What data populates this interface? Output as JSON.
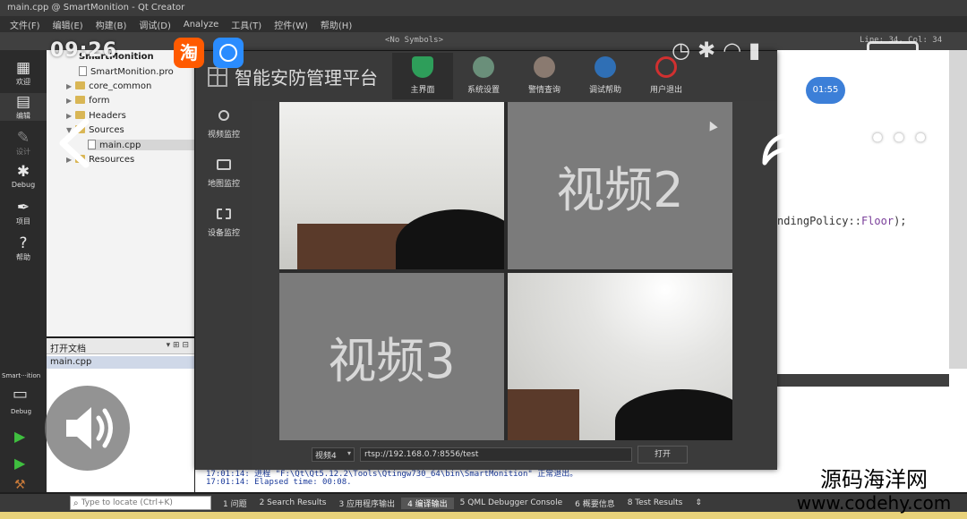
{
  "ide": {
    "window_title": "main.cpp @ SmartMonition - Qt Creator",
    "menu": [
      "文件(F)",
      "编辑(E)",
      "构建(B)",
      "调试(D)",
      "Analyze",
      "工具(T)",
      "控件(W)",
      "帮助(H)"
    ],
    "top_strip": {
      "symbols": "<No Symbols>",
      "line_col": "Line: 34, Col: 34"
    },
    "modes": [
      "欢迎",
      "编辑",
      "设计",
      "Debug",
      "项目",
      "帮助"
    ],
    "project_tree": [
      {
        "label": "SmartMonition",
        "kind": "root"
      },
      {
        "label": "SmartMonition.pro",
        "kind": "file"
      },
      {
        "label": "core_common",
        "kind": "folder"
      },
      {
        "label": "form",
        "kind": "folder"
      },
      {
        "label": "Headers",
        "kind": "folder"
      },
      {
        "label": "Sources",
        "kind": "folder"
      },
      {
        "label": "main.cpp",
        "kind": "file"
      },
      {
        "label": "Resources",
        "kind": "folder"
      }
    ],
    "open_docs": {
      "title": "打开文档",
      "items": [
        "main.cpp"
      ]
    },
    "run_selector": {
      "project": "Smart···ition",
      "config": "Debug"
    },
    "editor_visible_code": {
      "prefix": "ndingPolicy",
      "separator": "::",
      "keyword": "Floor",
      "suffix": ");"
    },
    "output_lines": [
      "17:01:14: 进程 \"F:\\Qt\\Qt5.12.2\\Tools\\Qtingw730_64\\bin\\SmartMonition\" 正常退出。",
      "17:01:14: Elapsed time: 00:08."
    ],
    "locator_placeholder": "Type to locate (Ctrl+K)",
    "output_tabs": [
      "1 问题",
      "2 Search Results",
      "3 应用程序输出",
      "4 编译输出",
      "5 QML Debugger Console",
      "6 概要信息",
      "8 Test Results"
    ],
    "active_output_tab": 3
  },
  "app": {
    "title": "智能安防管理平台",
    "nav": [
      {
        "label": "主界面",
        "icon": "shield-icon",
        "color": "#2e9e5a"
      },
      {
        "label": "系统设置",
        "icon": "gear-icon",
        "color": "#6a8f7a"
      },
      {
        "label": "警情查询",
        "icon": "search-icon",
        "color": "#8a7a70"
      },
      {
        "label": "调试帮助",
        "icon": "accessibility-icon",
        "color": "#2f6fb5"
      },
      {
        "label": "用户退出",
        "icon": "power-icon",
        "color": "#d03030"
      }
    ],
    "active_nav": 0,
    "sidebar": [
      {
        "label": "视频监控",
        "icon": "camera-icon"
      },
      {
        "label": "地图监控",
        "icon": "image-icon"
      },
      {
        "label": "设备监控",
        "icon": "device-icon"
      }
    ],
    "video_tiles": [
      {
        "type": "camera",
        "label": ""
      },
      {
        "type": "placeholder",
        "label": "视频2"
      },
      {
        "type": "placeholder",
        "label": "视频3"
      },
      {
        "type": "camera",
        "label": ""
      }
    ],
    "controls": {
      "channel": "视频4",
      "url": "rtsp://192.168.0.7:8556/test",
      "open_label": "打开"
    }
  },
  "phone_overlay": {
    "time": "09:26",
    "app_glyph": "淘",
    "timer_badge": "01:55"
  },
  "watermark": {
    "title": "源码海洋网",
    "url": "www.codehy.com"
  }
}
